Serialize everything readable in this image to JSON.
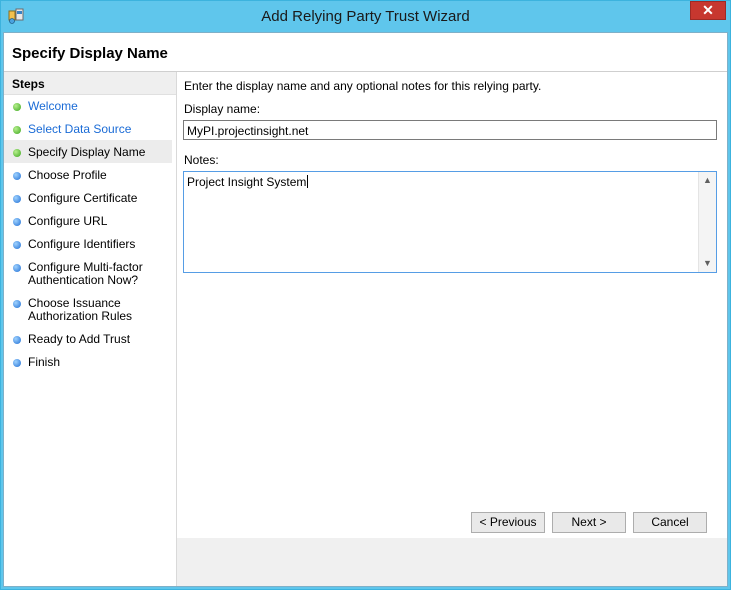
{
  "window": {
    "title": "Add Relying Party Trust Wizard",
    "close_glyph": "✕"
  },
  "page": {
    "title": "Specify Display Name"
  },
  "steps": {
    "heading": "Steps",
    "items": [
      {
        "label": "Welcome",
        "status": "done"
      },
      {
        "label": "Select Data Source",
        "status": "done"
      },
      {
        "label": "Specify Display Name",
        "status": "current"
      },
      {
        "label": "Choose Profile",
        "status": "pending"
      },
      {
        "label": "Configure Certificate",
        "status": "pending"
      },
      {
        "label": "Configure URL",
        "status": "pending"
      },
      {
        "label": "Configure Identifiers",
        "status": "pending"
      },
      {
        "label": "Configure Multi-factor\nAuthentication Now?",
        "status": "pending"
      },
      {
        "label": "Choose Issuance\nAuthorization Rules",
        "status": "pending"
      },
      {
        "label": "Ready to Add Trust",
        "status": "pending"
      },
      {
        "label": "Finish",
        "status": "pending"
      }
    ]
  },
  "form": {
    "intro": "Enter the display name and any optional notes for this relying party.",
    "display_name_label": "Display name:",
    "display_name_value": "MyPI.projectinsight.net",
    "notes_label": "Notes:",
    "notes_value": "Project Insight System"
  },
  "buttons": {
    "previous": "< Previous",
    "next": "Next >",
    "cancel": "Cancel"
  },
  "colors": {
    "titlebar": "#5fc6ec",
    "close": "#c7372f",
    "link": "#1a6bd6",
    "done_dot": "#3aa61c",
    "pending_dot": "#1f6ed4"
  }
}
